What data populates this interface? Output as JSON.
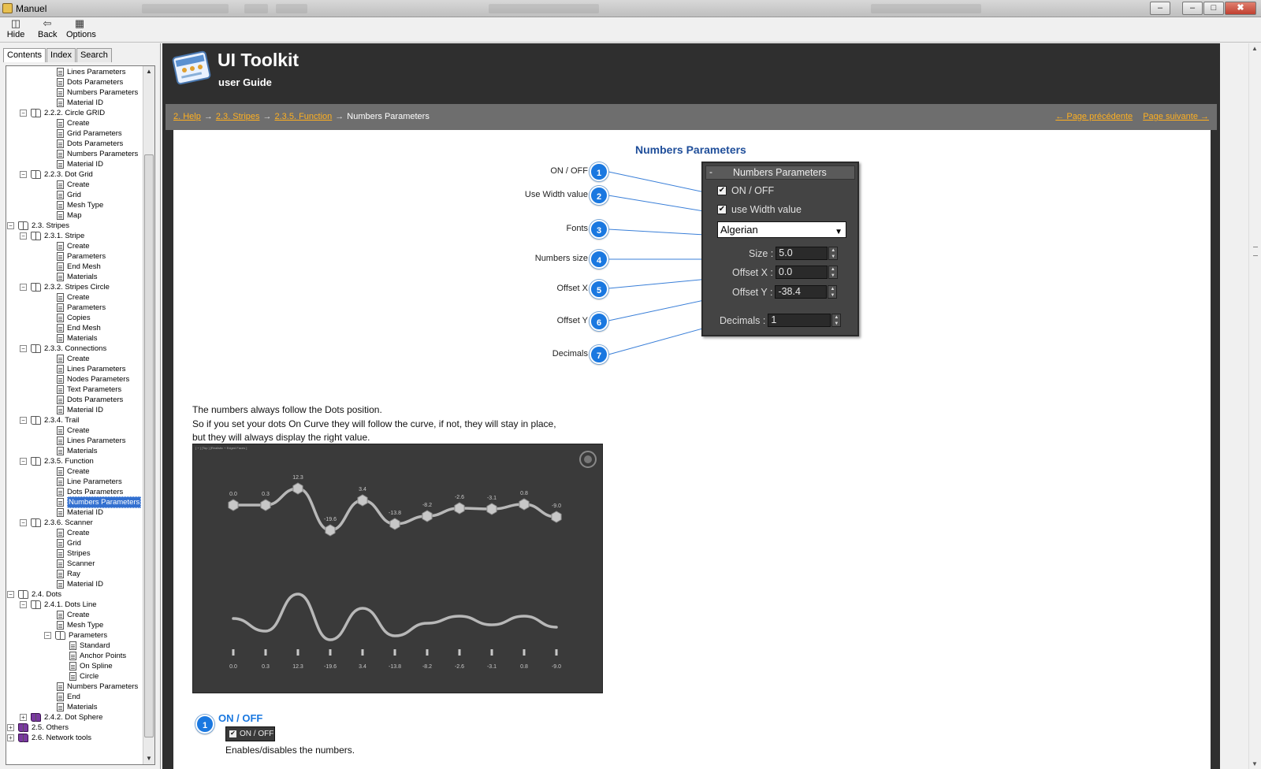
{
  "window": {
    "title": "Manuel",
    "buttons": [
      "–",
      "□",
      "✖"
    ],
    "inner_buttons": [
      "–",
      "□"
    ]
  },
  "toolbar": {
    "hide": "Hide",
    "back": "Back",
    "options": "Options"
  },
  "tabs": [
    "Contents",
    "Index",
    "Search"
  ],
  "tree": [
    {
      "level": 3,
      "icon": "page",
      "label": "Lines Parameters"
    },
    {
      "level": 3,
      "icon": "page",
      "label": "Dots Parameters"
    },
    {
      "level": 3,
      "icon": "page",
      "label": "Numbers Parameters"
    },
    {
      "level": 3,
      "icon": "page",
      "label": "Material ID"
    },
    {
      "level": 2,
      "icon": "book",
      "exp": "-",
      "label": "2.2.2. Circle GRID"
    },
    {
      "level": 3,
      "icon": "page",
      "label": "Create"
    },
    {
      "level": 3,
      "icon": "page",
      "label": "Grid Parameters"
    },
    {
      "level": 3,
      "icon": "page",
      "label": "Dots Parameters"
    },
    {
      "level": 3,
      "icon": "page",
      "label": "Numbers Parameters"
    },
    {
      "level": 3,
      "icon": "page",
      "label": "Material ID"
    },
    {
      "level": 2,
      "icon": "book",
      "exp": "-",
      "label": "2.2.3. Dot Grid"
    },
    {
      "level": 3,
      "icon": "page",
      "label": "Create"
    },
    {
      "level": 3,
      "icon": "page",
      "label": "Grid"
    },
    {
      "level": 3,
      "icon": "page",
      "label": "Mesh Type"
    },
    {
      "level": 3,
      "icon": "page",
      "label": "Map"
    },
    {
      "level": 1,
      "icon": "book",
      "exp": "-",
      "label": "2.3. Stripes"
    },
    {
      "level": 2,
      "icon": "book",
      "exp": "-",
      "label": "2.3.1. Stripe"
    },
    {
      "level": 3,
      "icon": "page",
      "label": "Create"
    },
    {
      "level": 3,
      "icon": "page",
      "label": "Parameters"
    },
    {
      "level": 3,
      "icon": "page",
      "label": "End Mesh"
    },
    {
      "level": 3,
      "icon": "page",
      "label": "Materials"
    },
    {
      "level": 2,
      "icon": "book",
      "exp": "-",
      "label": "2.3.2. Stripes Circle"
    },
    {
      "level": 3,
      "icon": "page",
      "label": "Create"
    },
    {
      "level": 3,
      "icon": "page",
      "label": "Parameters"
    },
    {
      "level": 3,
      "icon": "page",
      "label": "Copies"
    },
    {
      "level": 3,
      "icon": "page",
      "label": "End Mesh"
    },
    {
      "level": 3,
      "icon": "page",
      "label": "Materials"
    },
    {
      "level": 2,
      "icon": "book",
      "exp": "-",
      "label": "2.3.3. Connections"
    },
    {
      "level": 3,
      "icon": "page",
      "label": "Create"
    },
    {
      "level": 3,
      "icon": "page",
      "label": "Lines Parameters"
    },
    {
      "level": 3,
      "icon": "page",
      "label": "Nodes Parameters"
    },
    {
      "level": 3,
      "icon": "page",
      "label": "Text Parameters"
    },
    {
      "level": 3,
      "icon": "page",
      "label": "Dots Parameters"
    },
    {
      "level": 3,
      "icon": "page",
      "label": "Material ID"
    },
    {
      "level": 2,
      "icon": "book",
      "exp": "-",
      "label": "2.3.4. Trail"
    },
    {
      "level": 3,
      "icon": "page",
      "label": "Create"
    },
    {
      "level": 3,
      "icon": "page",
      "label": "Lines Parameters"
    },
    {
      "level": 3,
      "icon": "page",
      "label": "Materials"
    },
    {
      "level": 2,
      "icon": "book",
      "exp": "-",
      "label": "2.3.5. Function"
    },
    {
      "level": 3,
      "icon": "page",
      "label": "Create"
    },
    {
      "level": 3,
      "icon": "page",
      "label": "Line Parameters"
    },
    {
      "level": 3,
      "icon": "page",
      "label": "Dots Parameters"
    },
    {
      "level": 3,
      "icon": "page",
      "label": "Numbers Parameters",
      "selected": true
    },
    {
      "level": 3,
      "icon": "page",
      "label": "Material ID"
    },
    {
      "level": 2,
      "icon": "book",
      "exp": "-",
      "label": "2.3.6. Scanner"
    },
    {
      "level": 3,
      "icon": "page",
      "label": "Create"
    },
    {
      "level": 3,
      "icon": "page",
      "label": "Grid"
    },
    {
      "level": 3,
      "icon": "page",
      "label": "Stripes"
    },
    {
      "level": 3,
      "icon": "page",
      "label": "Scanner"
    },
    {
      "level": 3,
      "icon": "page",
      "label": "Ray"
    },
    {
      "level": 3,
      "icon": "page",
      "label": "Material ID"
    },
    {
      "level": 1,
      "icon": "book",
      "exp": "-",
      "label": "2.4. Dots"
    },
    {
      "level": 2,
      "icon": "book",
      "exp": "-",
      "label": "2.4.1. Dots Line"
    },
    {
      "level": 3,
      "icon": "page",
      "label": "Create"
    },
    {
      "level": 3,
      "icon": "page",
      "label": "Mesh Type"
    },
    {
      "level": 3,
      "icon": "book",
      "exp": "-",
      "label": "Parameters"
    },
    {
      "level": 4,
      "icon": "page",
      "label": "Standard"
    },
    {
      "level": 4,
      "icon": "page",
      "label": "Anchor Points"
    },
    {
      "level": 4,
      "icon": "page",
      "label": "On Spline"
    },
    {
      "level": 4,
      "icon": "page",
      "label": "Circle"
    },
    {
      "level": 3,
      "icon": "page",
      "label": "Numbers Parameters"
    },
    {
      "level": 3,
      "icon": "page",
      "label": "End"
    },
    {
      "level": 3,
      "icon": "page",
      "label": "Materials"
    },
    {
      "level": 2,
      "icon": "book-purple",
      "exp": "+",
      "label": "2.4.2. Dot Sphere"
    },
    {
      "level": 1,
      "icon": "book-purple",
      "exp": "+",
      "label": "2.5. Others"
    },
    {
      "level": 1,
      "icon": "book-purple",
      "exp": "+",
      "label": "2.6. Network tools"
    }
  ],
  "header": {
    "title": "UI Toolkit",
    "subtitle": "user Guide"
  },
  "breadcrumb": {
    "items": [
      "2. Help",
      "2.3. Stripes",
      "2.3.5. Function"
    ],
    "current": "Numbers Parameters",
    "separator": "→",
    "prev": "← Page précédente",
    "next": "Page suivante →"
  },
  "content": {
    "section_title": "Numbers Parameters",
    "callouts": [
      {
        "num": "1",
        "label": "ON / OFF"
      },
      {
        "num": "2",
        "label": "Use Width value"
      },
      {
        "num": "3",
        "label": "Fonts"
      },
      {
        "num": "4",
        "label": "Numbers size"
      },
      {
        "num": "5",
        "label": "Offset X"
      },
      {
        "num": "6",
        "label": "Offset Y"
      },
      {
        "num": "7",
        "label": "Decimals"
      }
    ],
    "panel": {
      "minus": "-",
      "title": "Numbers Parameters",
      "on_off": "ON / OFF",
      "use_width": "use Width value",
      "font": "Algerian",
      "size_label": "Size :",
      "size_value": "5.0",
      "offx_label": "Offset X :",
      "offx_value": "0.0",
      "offy_label": "Offset Y :",
      "offy_value": "-38.4",
      "decimals_label": "Decimals :",
      "decimals_value": "1"
    },
    "para": [
      "The numbers always follow the Dots position.",
      "So if you set your dots On Curve they will follow the curve, if not, they will stay in place,",
      "but they will always display the right value."
    ],
    "viewport_label": "[ + ] [Top ] [Realistic + Edged Faces ]",
    "values": [
      "0.0",
      "0.3",
      "12.3",
      "-19.6",
      "3.4",
      "-13.8",
      "-8.2",
      "-2.6",
      "-3.1",
      "0.8",
      "-9.0"
    ],
    "detail": {
      "num": "1",
      "title": "ON / OFF",
      "chip": "ON / OFF",
      "text": "Enables/disables the numbers."
    }
  },
  "colors": {
    "accent": "#1a78e0",
    "link": "#ffb020",
    "header_bg": "#2f2f2f",
    "navbar_bg": "#6e6e6e",
    "title_blue": "#1f4e9a"
  }
}
